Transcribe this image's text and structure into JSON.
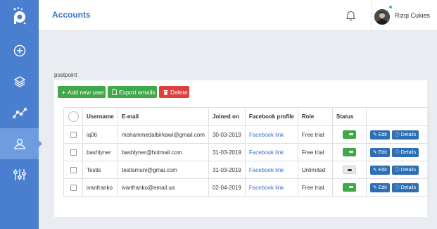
{
  "header": {
    "title": "Accounts",
    "user_name": "Rizqi Cukies"
  },
  "section_label": "postpoint",
  "toolbar": {
    "add_label": "Add new user",
    "export_label": "Export emails",
    "delete_label": "Delete"
  },
  "table": {
    "columns": [
      "Username",
      "E-mail",
      "Joined on",
      "Facebook profile",
      "Role",
      "Status"
    ],
    "rows": [
      {
        "username": "iq06",
        "email": "mohammedalbirkawi@gmail.com",
        "joined": "30-03-2019",
        "facebook": "Facebook link",
        "role": "Free trial",
        "status": "on"
      },
      {
        "username": "bashlyner",
        "email": "bashlyner@hotmail.com",
        "joined": "31-03-2019",
        "facebook": "Facebook link",
        "role": "Free trial",
        "status": "on"
      },
      {
        "username": "Testis",
        "email": "testismuni@gmai.com",
        "joined": "31-03-2019",
        "facebook": "Facebook link",
        "role": "Unlimited",
        "status": "off"
      },
      {
        "username": "ivanfranko",
        "email": "ivanfranko@email.ua",
        "joined": "02-04-2019",
        "facebook": "Facebook link",
        "role": "Free trial",
        "status": "on"
      }
    ],
    "edit_label": "Edit",
    "details_label": "Details"
  },
  "icons": {
    "sidebar": [
      "plus-circle-icon",
      "layers-icon",
      "chart-line-icon",
      "user-icon",
      "sliders-icon"
    ],
    "bell": "bell-icon"
  },
  "colors": {
    "sidebar": "#4a7fd0",
    "accent": "#3c74c7",
    "green": "#3fa848",
    "red": "#e0403b",
    "action": "#2d6eb4"
  }
}
